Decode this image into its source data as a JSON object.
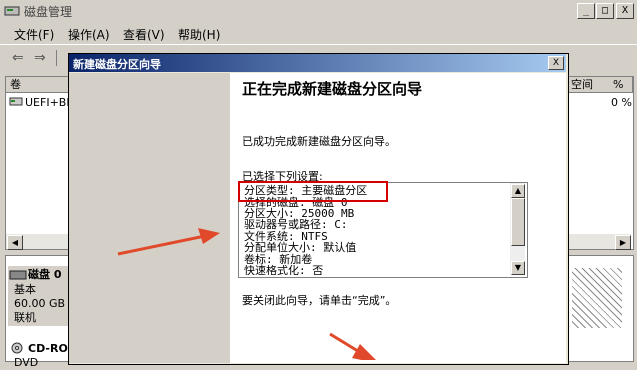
{
  "window": {
    "title": "磁盘管理",
    "buttons": {
      "minimize": "_",
      "maximize": "□",
      "close": "X"
    }
  },
  "menubar": [
    {
      "label": "文件(F)"
    },
    {
      "label": "操作(A)"
    },
    {
      "label": "查看(V)"
    },
    {
      "label": "帮助(H)"
    }
  ],
  "volume_list": {
    "columns": {
      "volume": "卷",
      "free": "空间",
      "percent": "%"
    },
    "rows": [
      {
        "volume": "UEFI+BI",
        "percent": "0 %"
      }
    ]
  },
  "disk_panel": {
    "disk0": {
      "name": "磁盘 0",
      "type": "基本",
      "size": "60.00 GB",
      "status": "联机"
    },
    "cdrom": {
      "name": "CD-RO",
      "type": "DVD"
    }
  },
  "dialog": {
    "title": "新建磁盘分区向导",
    "heading": "正在完成新建磁盘分区向导",
    "completed_text": "已成功完成新建磁盘分区向导。",
    "selected_label": "已选择下列设置:",
    "settings": [
      "分区类型: 主要磁盘分区",
      "选择的磁盘: 磁盘 0",
      "分区大小: 25000 MB",
      "驱动器号或路径: C:",
      "文件系统: NTFS",
      "分配单位大小: 默认值",
      "卷标: 新加卷",
      "快速格式化: 否"
    ],
    "close_hint": "要关闭此向导，请单击“完成”。"
  },
  "colors": {
    "highlight_box": "#d40000",
    "arrow": "#e04a2a",
    "titlebar_dark": "#0a246a",
    "titlebar_light": "#a6caf0"
  }
}
